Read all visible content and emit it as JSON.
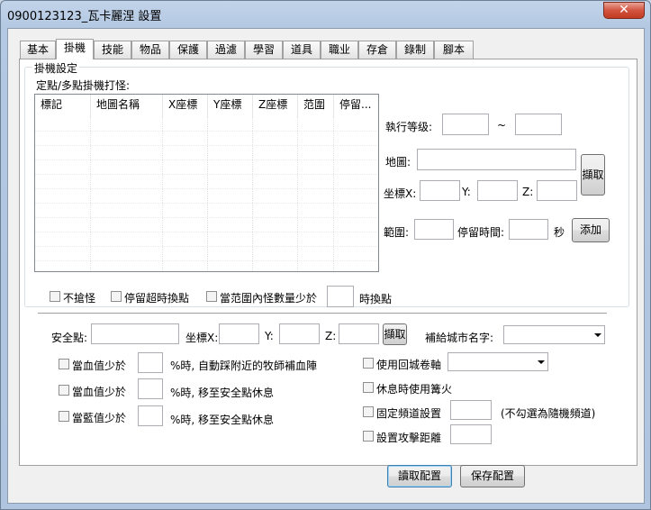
{
  "window": {
    "title": "0900123123_瓦卡麗涅   設置",
    "close_glyph": "✕"
  },
  "tabs": [
    {
      "label": "基本"
    },
    {
      "label": "掛機"
    },
    {
      "label": "技能"
    },
    {
      "label": "物品"
    },
    {
      "label": "保護"
    },
    {
      "label": "過濾"
    },
    {
      "label": "學習"
    },
    {
      "label": "道具"
    },
    {
      "label": "職业"
    },
    {
      "label": "存倉"
    },
    {
      "label": "錄制"
    },
    {
      "label": "腳本"
    }
  ],
  "active_tab": "掛機",
  "group_title": "掛機設定",
  "fixed_point_label": "定點/多點掛機打怪:",
  "monster_table": {
    "columns": [
      "標記",
      "地圖名稱",
      "X座標",
      "Y座標",
      "Z座標",
      "范圍",
      "停留..."
    ],
    "rows": []
  },
  "exec_level": {
    "label": "執行等级:",
    "separator": "~",
    "min": "",
    "max": ""
  },
  "map": {
    "label": "地圖:",
    "value": "",
    "fetch_button": "擷取"
  },
  "coords": {
    "label": "坐標X:",
    "y_label": "Y:",
    "z_label": "Z:",
    "x": "",
    "y": "",
    "z": ""
  },
  "range": {
    "label": "範圍:",
    "value": "",
    "stay_label": "停留時間:",
    "stay_value": "",
    "unit": "秒",
    "add_button": "添加"
  },
  "options_row": {
    "no_steal": "不搶怪",
    "stay_timeout": "停留超時換點",
    "few_monsters_prefix": "當范圍內怪數量少於",
    "few_monsters_suffix": "時換點",
    "few_monsters_value": ""
  },
  "safe_point": {
    "label": "安全點:",
    "value": "",
    "coord_label": "坐標X:",
    "y_label": "Y:",
    "z_label": "Z:",
    "x": "",
    "y": "",
    "z": "",
    "fetch_button": "擷取",
    "city_label": "補給城市名字:",
    "city_value": ""
  },
  "hp_rules": [
    {
      "prefix": "當血值少於",
      "suffix": "%時, 自動踩附近的牧師補血陣",
      "value": ""
    },
    {
      "prefix": "當血值少於",
      "suffix": "%時, 移至安全點休息",
      "value": ""
    },
    {
      "prefix": "當藍值少於",
      "suffix": "%時, 移至安全點休息",
      "value": ""
    }
  ],
  "right_options": {
    "return_scroll": "使用回城卷軸",
    "return_scroll_value": "",
    "campfire": "休息時使用篝火",
    "fixed_channel": "固定頻道設置",
    "fixed_channel_value": "",
    "fixed_channel_hint": "(不勾選為隨機頻道)",
    "attack_range": "設置攻擊距離",
    "attack_range_value": ""
  },
  "footer": {
    "read_button": "讀取配置",
    "save_button": "保存配置"
  }
}
